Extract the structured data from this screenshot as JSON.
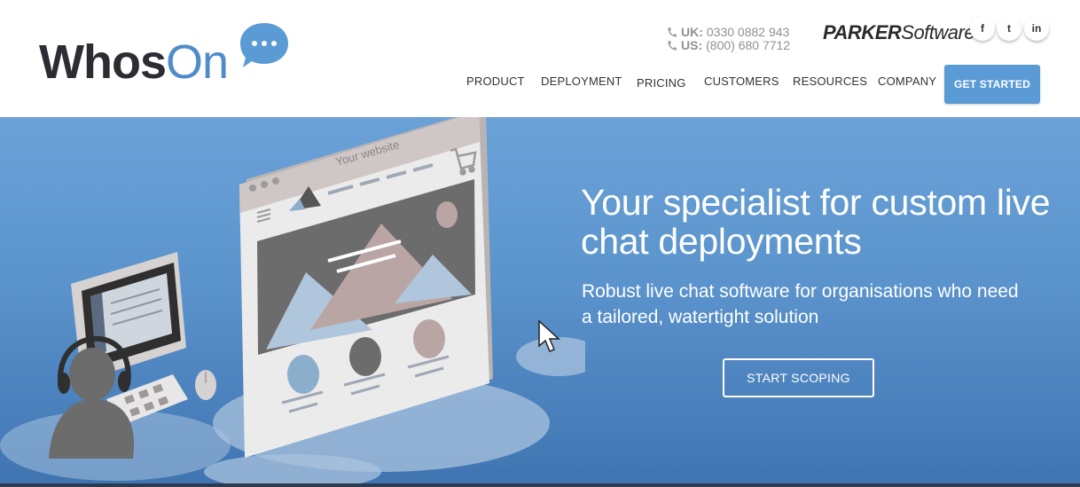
{
  "header": {
    "logo": {
      "part1": "Whos",
      "part2": "On"
    },
    "phones": [
      {
        "label": "UK:",
        "number": "0330 0882 943"
      },
      {
        "label": "US:",
        "number": "(800) 680 7712"
      }
    ],
    "parker_logo": {
      "part1": "PARKER",
      "part2": "Software"
    },
    "social": {
      "facebook": "f",
      "twitter": "t",
      "linkedin": "in"
    },
    "nav": [
      "PRODUCT",
      "DEPLOYMENT",
      "PRICING",
      "CUSTOMERS",
      "RESOURCES",
      "COMPANY"
    ],
    "cta": "GET STARTED"
  },
  "hero": {
    "title": "Your specialist for custom live chat deployments",
    "subtitle": "Robust live chat software for organisations who need a tailored, watertight solution",
    "cta": "START SCOPING",
    "illustration": {
      "website_label": "Your website"
    }
  },
  "colors": {
    "accent": "#5b9bd5",
    "hero_top": "#6aa2d8",
    "hero_bottom": "#3f74b1",
    "logo_dark": "#2b2d33",
    "logo_blue": "#4f8cc9"
  }
}
